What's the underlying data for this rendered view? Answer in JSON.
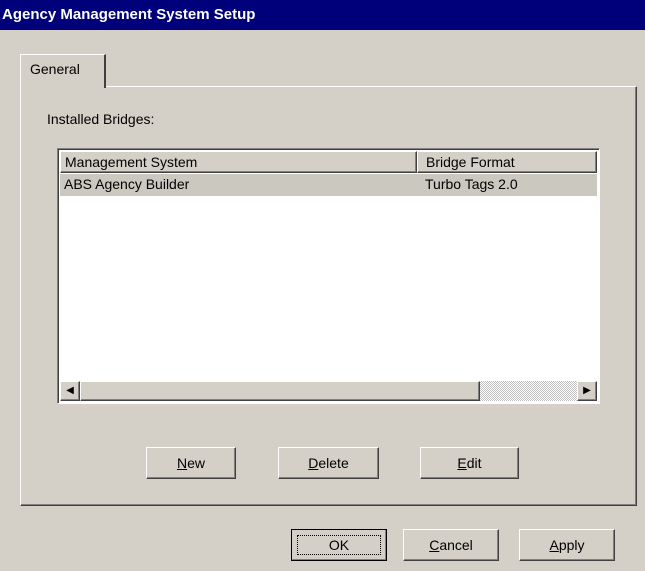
{
  "window": {
    "title": "Agency Management System Setup"
  },
  "tabs": [
    {
      "label": "General",
      "active": true
    }
  ],
  "general": {
    "installed_label": "Installed Bridges:",
    "columns": [
      "Management System",
      "Bridge Format"
    ],
    "rows": [
      {
        "management_system": "ABS Agency Builder",
        "bridge_format": "Turbo Tags 2.0",
        "selected": true
      }
    ],
    "buttons": {
      "new": {
        "pre": "",
        "mnemonic": "N",
        "post": "ew"
      },
      "delete": {
        "pre": "",
        "mnemonic": "D",
        "post": "elete"
      },
      "edit": {
        "pre": "",
        "mnemonic": "E",
        "post": "dit"
      }
    }
  },
  "footer": {
    "ok": {
      "pre": "",
      "mnemonic": "",
      "post": "OK"
    },
    "cancel": {
      "pre": "",
      "mnemonic": "C",
      "post": "ancel"
    },
    "apply": {
      "pre": "",
      "mnemonic": "A",
      "post": "pply"
    }
  },
  "icons": {
    "scroll_left": "scroll-left-arrow-icon",
    "scroll_right": "scroll-right-arrow-icon"
  },
  "colors": {
    "titlebar": "#00007b",
    "face": "#d4d0c8",
    "selection": "#cbc8c0"
  }
}
